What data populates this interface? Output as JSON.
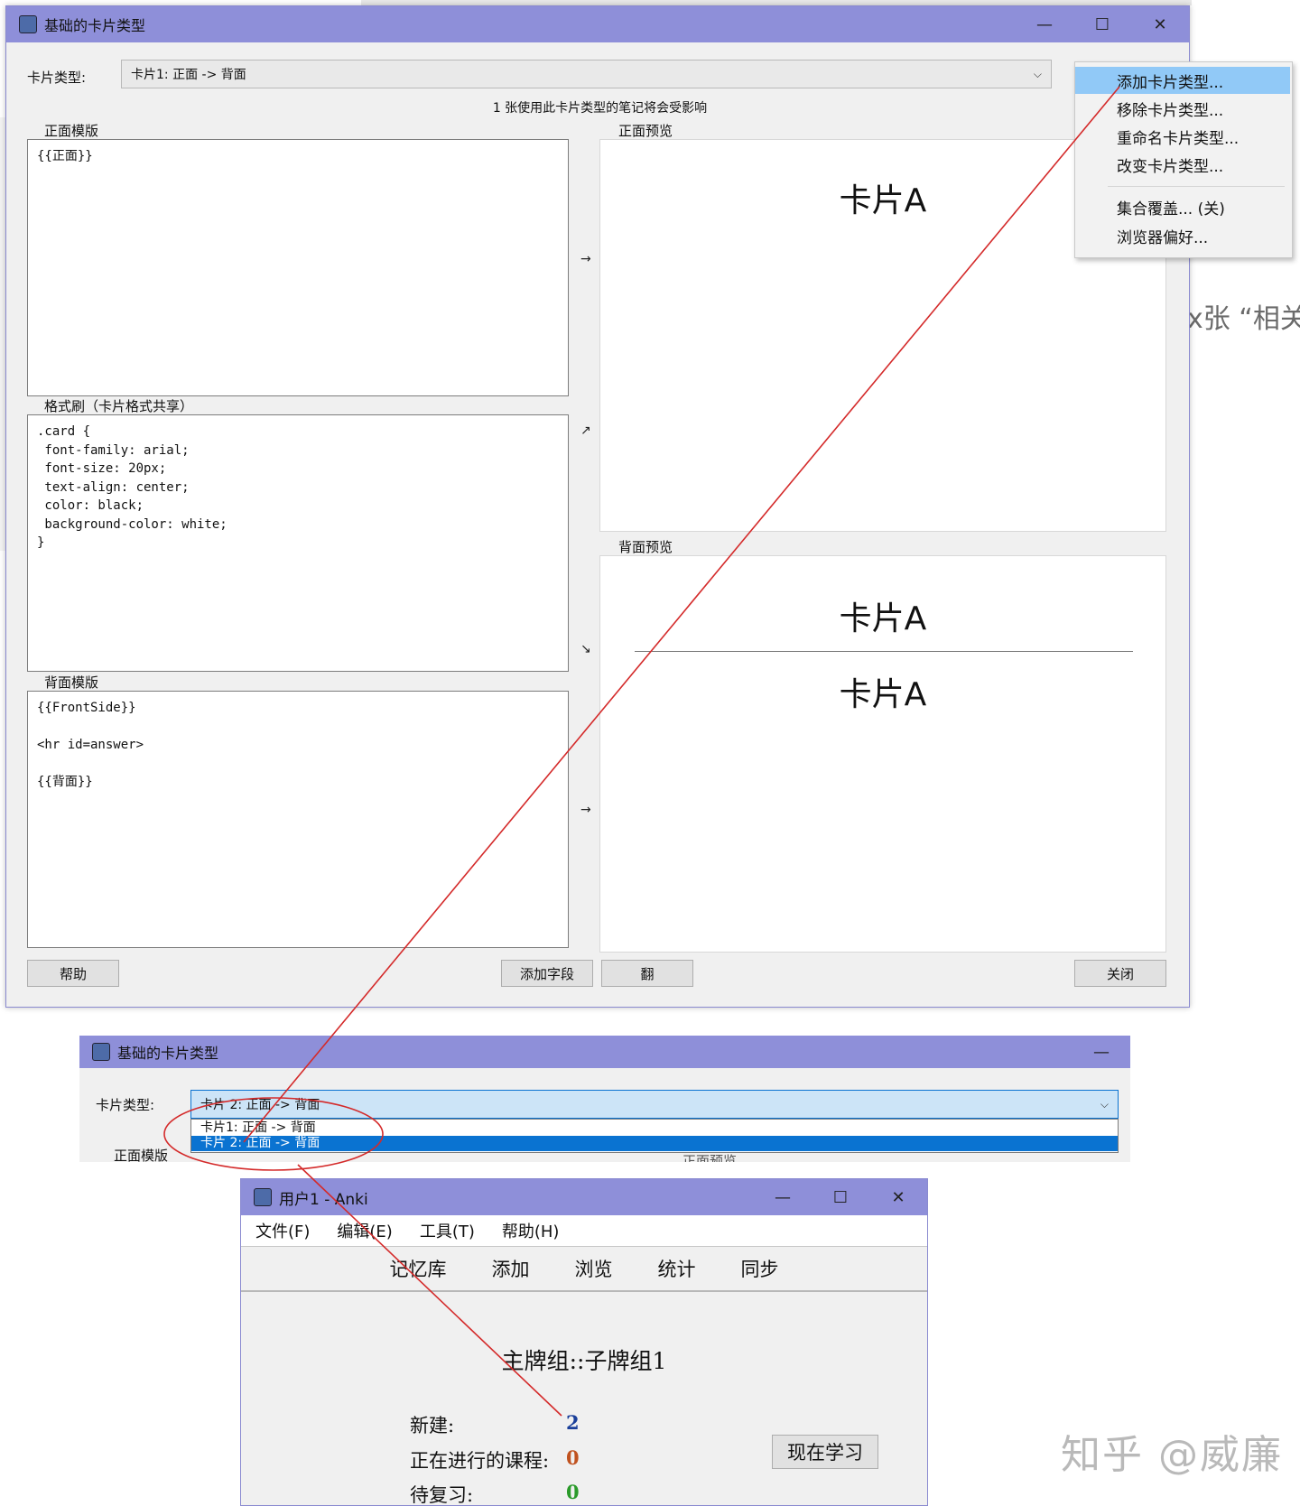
{
  "background": {
    "right_text": "x张 “相关"
  },
  "main_window": {
    "title": "基础的卡片类型",
    "controls": {
      "minimize": "—",
      "maximize": "☐",
      "close": "✕"
    },
    "card_type_label": "卡片类型:",
    "card_type_value": "卡片1: 正面 -> 背面",
    "notice": "1 张使用此卡片类型的笔记将会受影响",
    "front_template": {
      "label": "正面模版",
      "content": "{{正面}}"
    },
    "styling": {
      "label": "格式刷（卡片格式共享）",
      "content": ".card {\n font-family: arial;\n font-size: 20px;\n text-align: center;\n color: black;\n background-color: white;\n}"
    },
    "back_template": {
      "label": "背面模版",
      "content": "{{FrontSide}}\n\n<hr id=answer>\n\n{{背面}}"
    },
    "front_preview": {
      "label": "正面预览",
      "text": "卡片A"
    },
    "back_preview": {
      "label": "背面预览",
      "question": "卡片A",
      "answer": "卡片A"
    },
    "arrows": {
      "a1": "→",
      "a2": "↗",
      "a3": "↘",
      "a4": "→"
    },
    "buttons": {
      "help": "帮助",
      "add_field": "添加字段",
      "flip": "翻",
      "close": "关闭"
    }
  },
  "context_menu": {
    "items": [
      "添加卡片类型...",
      "移除卡片类型...",
      "重命名卡片类型...",
      "改变卡片类型...",
      "集合覆盖... (关)",
      "浏览器偏好..."
    ],
    "selected_index": 0
  },
  "second_window": {
    "title": "基础的卡片类型",
    "minimize": "—",
    "card_type_label": "卡片类型:",
    "card_type_value": "卡片 2: 正面 -> 背面",
    "options": [
      "卡片1: 正面 -> 背面",
      "卡片 2: 正面 -> 背面"
    ],
    "selected_option_index": 1,
    "front_template_label": "正面模版",
    "front_preview_label": "正面预览"
  },
  "anki_window": {
    "title": "用户1 - Anki",
    "controls": {
      "minimize": "—",
      "maximize": "☐",
      "close": "✕"
    },
    "menu": [
      "文件(F)",
      "编辑(E)",
      "工具(T)",
      "帮助(H)"
    ],
    "toolbar": [
      "记忆库",
      "添加",
      "浏览",
      "统计",
      "同步"
    ],
    "deck_title": "主牌组::子牌组1",
    "stats": [
      {
        "label": "新建:",
        "value": "2",
        "color": "#1a3f9a"
      },
      {
        "label": "正在进行的课程:",
        "value": "0",
        "color": "#c0521f"
      },
      {
        "label": "待复习:",
        "value": "0",
        "color": "#2a9a2a"
      }
    ],
    "study_button": "现在学习"
  },
  "watermark": "知乎 @威廉",
  "colors": {
    "titlebar": "#8e8fd9",
    "menu_highlight": "#91c9f7",
    "selection": "#0a73d1",
    "annotation": "#d42a2a"
  }
}
